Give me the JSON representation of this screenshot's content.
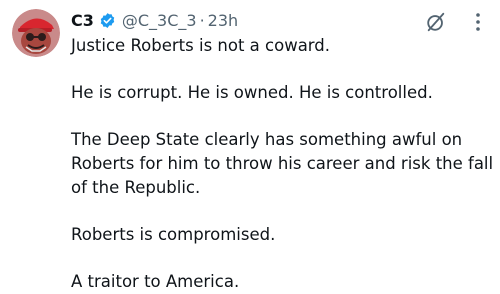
{
  "post": {
    "author": {
      "display_name": "C3",
      "handle": "@C_3C_3",
      "separator": "·",
      "time": "23h",
      "verified": true,
      "avatar_icon": "avatar-cartoon-red-cap"
    },
    "paragraphs": [
      "Justice Roberts is not a coward.",
      "He is corrupt. He is owned. He is controlled.",
      "The Deep State clearly has something awful on Roberts for him to throw his career and risk the fall of the Republic.",
      "Roberts is compromised.",
      "A traitor to America."
    ],
    "icons": {
      "verified": "verified-badge-icon",
      "grok": "grok-icon",
      "more": "more-options-icon"
    }
  },
  "colors": {
    "text": "#0f1419",
    "secondary": "#536471",
    "verified": "#1d9bf0",
    "background": "#ffffff"
  }
}
